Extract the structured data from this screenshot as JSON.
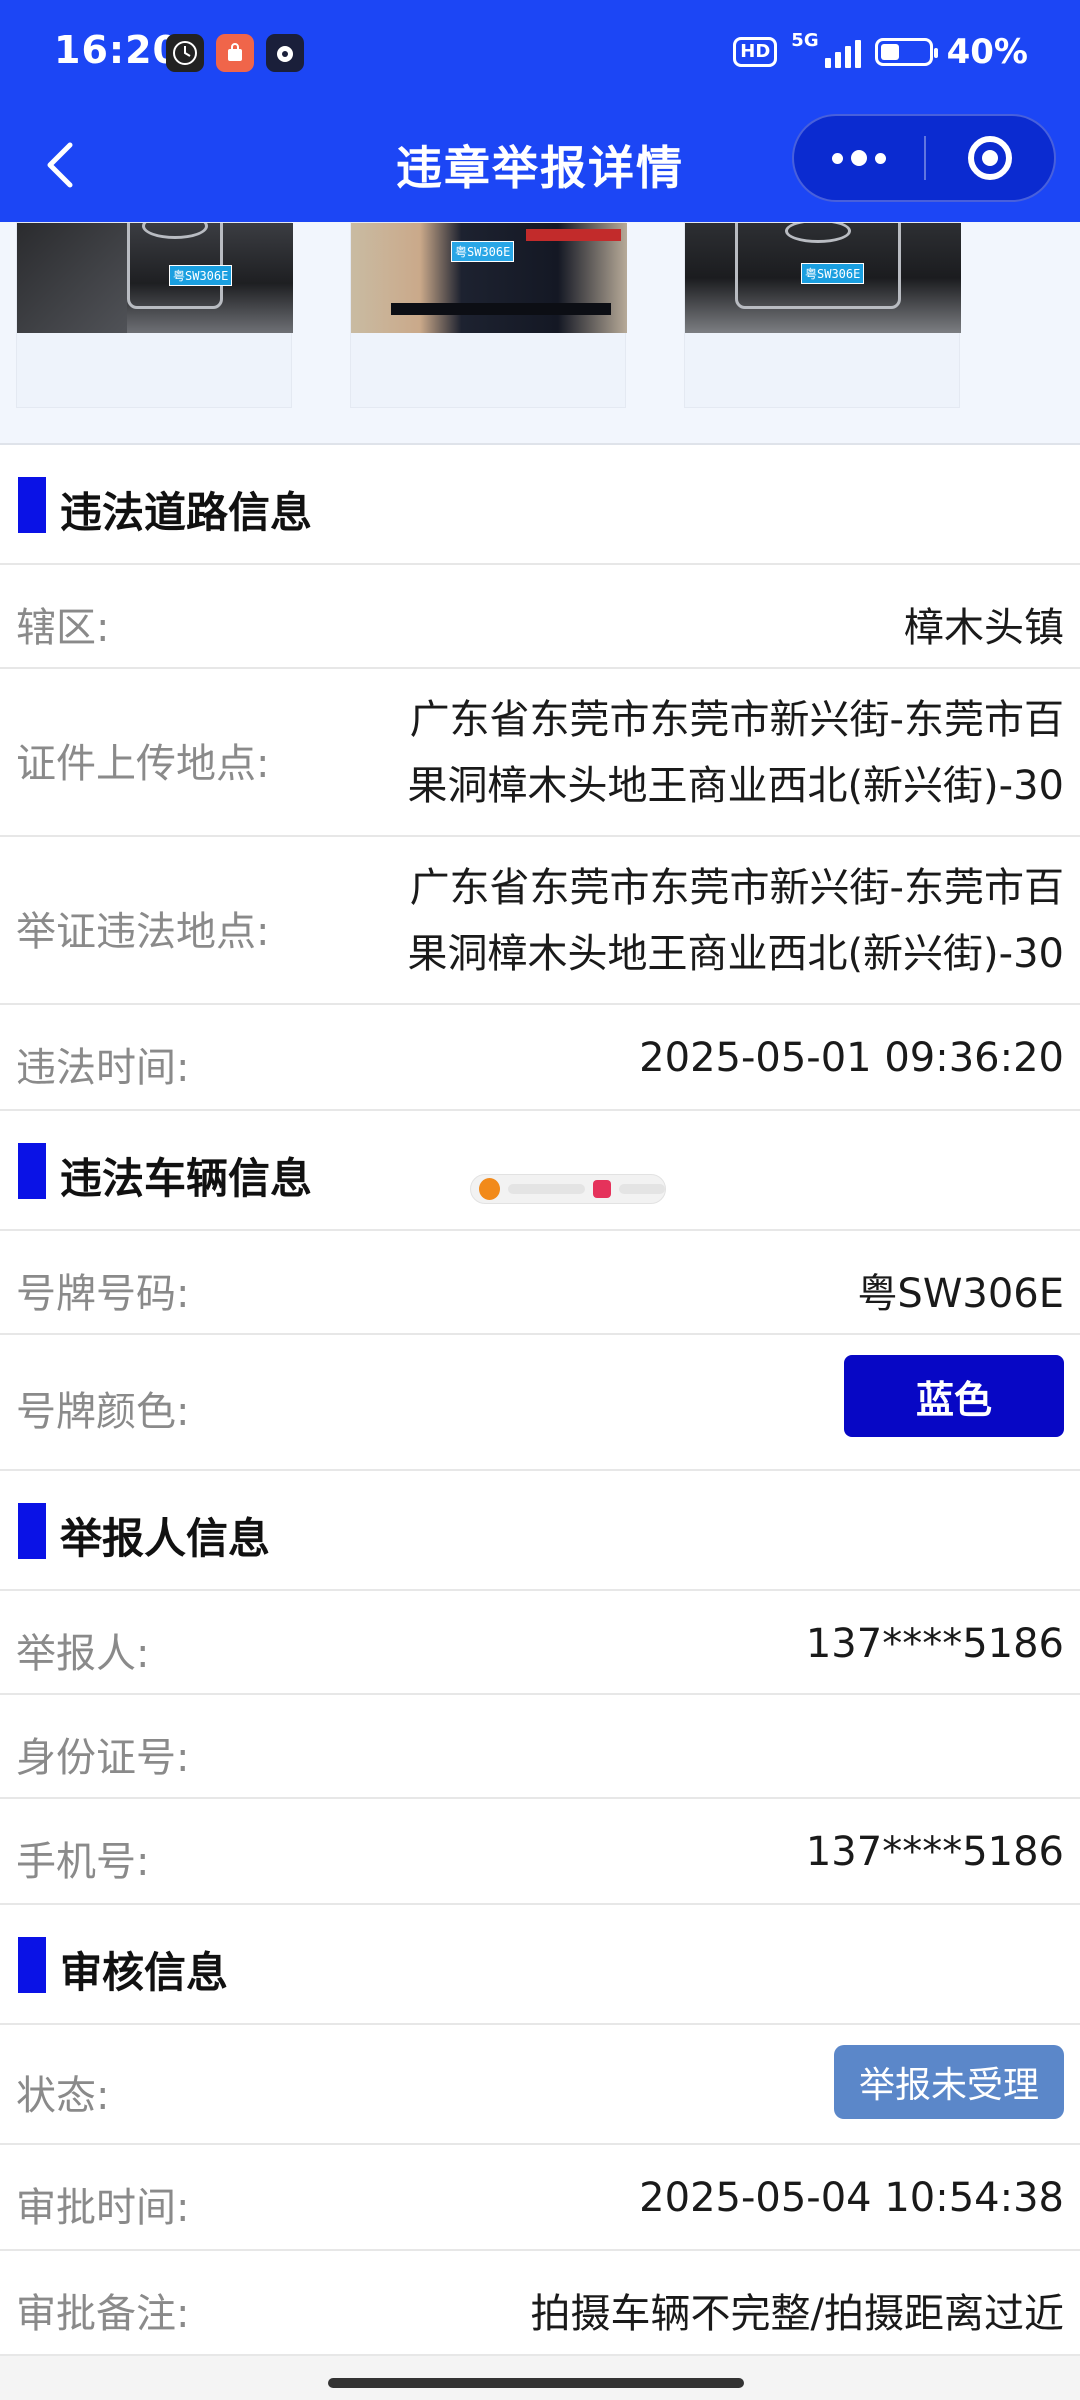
{
  "status_bar": {
    "time": "16:20",
    "network": "5G",
    "hd": "HD",
    "battery_percent": "40%",
    "battery_level": 0.4
  },
  "nav": {
    "title": "违章举报详情"
  },
  "sections": {
    "road": {
      "title": "违法道路信息",
      "district_label": "辖区:",
      "district_value": "樟木头镇",
      "upload_label": "证件上传地点:",
      "upload_line1": "广东省东莞市东莞市新兴街-东莞市百",
      "upload_line2": "果洞樟木头地王商业西北(新兴街)-30",
      "evidence_label": "举证违法地点:",
      "evidence_line1": "广东省东莞市东莞市新兴街-东莞市百",
      "evidence_line2": "果洞樟木头地王商业西北(新兴街)-30",
      "time_label": "违法时间:",
      "time_value": "2025-05-01 09:36:20"
    },
    "vehicle": {
      "title": "违法车辆信息",
      "plate_label": "号牌号码:",
      "plate_value": "粤SW306E",
      "color_label": "号牌颜色:",
      "color_value": "蓝色"
    },
    "reporter": {
      "title": "举报人信息",
      "name_label": "举报人:",
      "name_value": "137****5186",
      "id_label": "身份证号:",
      "id_value": "",
      "phone_label": "手机号:",
      "phone_value": "137****5186"
    },
    "review": {
      "title": "审核信息",
      "status_label": "状态:",
      "status_value": "举报未受理",
      "time_label": "审批时间:",
      "time_value": "2025-05-04 10:54:38",
      "note_label": "审批备注:",
      "note_value": "拍摄车辆不完整/拍摄距离过近"
    }
  },
  "colors": {
    "header": "#1c46f5",
    "section_bar": "#0a12e6",
    "plate_tag": "#0707c5",
    "status_tag": "#5b87c9"
  },
  "photos": {
    "plate_texts": [
      "粤SW306E",
      "粤SW306E",
      "粤SW306E"
    ]
  }
}
